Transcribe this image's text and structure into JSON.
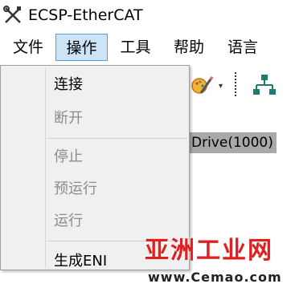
{
  "window": {
    "title": "ECSP-EtherCAT"
  },
  "menubar": {
    "items": [
      {
        "label": "文件"
      },
      {
        "label": "操作"
      },
      {
        "label": "工具"
      },
      {
        "label": "帮助"
      },
      {
        "label": "语言"
      }
    ]
  },
  "operations_menu": {
    "connect": "连接",
    "disconnect": "断开",
    "stop": "停止",
    "pre_run": "预运行",
    "run": "运行",
    "generate_eni": "生成ENI"
  },
  "main": {
    "drive_label": "Drive(1000)"
  },
  "toolbar": {
    "dropdown_glyph": "▾"
  },
  "watermark": {
    "main": "亚洲工业网",
    "url": "www.Cemao.com"
  },
  "colors": {
    "menu_active_bg": "#cde4f7",
    "menu_active_border": "#5aa0d9",
    "drive_highlight": "#a9a9a9",
    "watermark_red": "#e02020"
  }
}
